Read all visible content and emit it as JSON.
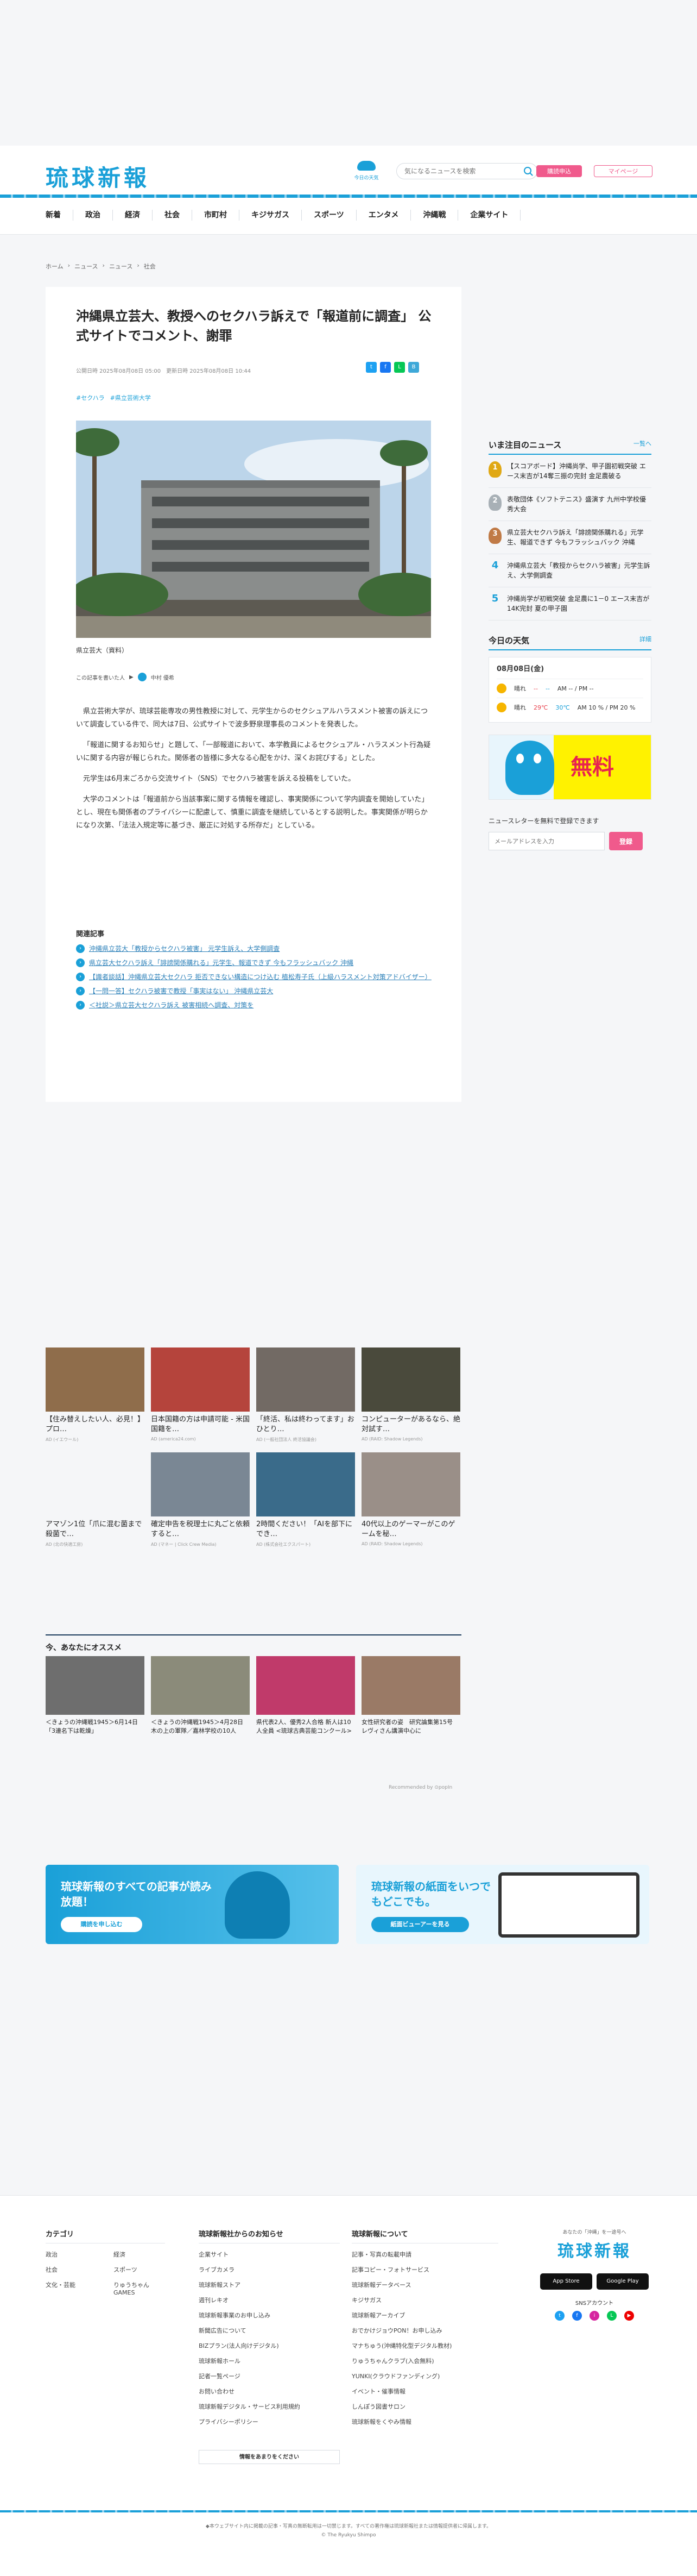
{
  "header": {
    "logo": "琉球新報",
    "weather_label": "今日の天気",
    "search_placeholder": "気になるニュースを検索",
    "subscribe": "購読申込",
    "mypage": "マイページ"
  },
  "nav": [
    "新着",
    "政治",
    "経済",
    "社会",
    "市町村",
    "キジサガス",
    "スポーツ",
    "エンタメ",
    "沖縄戦",
    "企業サイト"
  ],
  "breadcrumb": [
    "ホーム",
    "ニュース",
    "ニュース",
    "社会"
  ],
  "article": {
    "title": "沖縄県立芸大、教授へのセクハラ訴えで「報道前に調査」 公式サイトでコメント、謝罪",
    "published": "公開日時 2025年08月08日 05:00",
    "updated": "更新日時 2025年08月08日 10:44",
    "tags": [
      "#セクハラ",
      "#県立芸術大学"
    ],
    "photo_caption": "県立芸大（資料）",
    "author_label": "この記事を書いた人",
    "author": "中村 優希",
    "paragraphs": [
      "県立芸術大学が、琉球芸能専攻の男性教授に対して、元学生からのセクシュアルハラスメント被害の訴えについて調査している件で、同大は7日、公式サイトで波多野泉理事長のコメントを発表した。",
      "「報道に関するお知らせ」と題して、「一部報道において、本学教員によるセクシュアル・ハラスメント行為疑いに関する内容が報じられた。関係者の皆様に多大なる心配をかけ、深くお詫びする」とした。",
      "元学生は6月末ごろから交流サイト（SNS）でセクハラ被害を訴える投稿をしていた。",
      "大学のコメントは「報道前から当該事案に関する情報を確認し、事実関係について学内調査を開始していた」とし、現在も関係者のプライバシーに配慮して、慎重に調査を継続しているとする説明した。事実関係が明らかになり次第、「法法入規定等に基づき、厳正に対処する所存だ」としている。"
    ],
    "related_label": "関連記事",
    "related": [
      "沖縄県立芸大「教授からセクハラ被害」 元学生訴え、大学側調査",
      "県立芸大セクハラ訴え「誹謗関係購れる」元学生、報道できず 今もフラッシュバック 沖縄",
      "【識者談話】沖縄県立芸大セクハラ 拒否できない構造につけ込む 植松寿子氏（上級ハラスメント対策アドバイザー）",
      "【一問一答】セクハラ被害で教授「事実はない」 沖縄県立芸大",
      "＜社説＞県立芸大セクハラ訴え 被害相続へ調査、対策を"
    ]
  },
  "sidebar": {
    "ranking_title": "いま注目のニュース",
    "ranking_more": "一覧へ",
    "ranking": [
      {
        "n": "1",
        "text": "【スコアボード】沖縄尚学、甲子園初戦突破 エース末吉が14奪三振の完封 金足農破る"
      },
      {
        "n": "2",
        "text": "表敬団体《ソフトテニス》盛演す 九州中学校優秀大会"
      },
      {
        "n": "3",
        "text": "県立芸大セクハラ訴え「誹謗関係購れる」元学生、報道できず 今もフラッシュバック 沖縄"
      },
      {
        "n": "4",
        "text": "沖縄県立芸大「教授からセクハラ被害」元学生訴え、大学側調査"
      },
      {
        "n": "5",
        "text": "沖縄尚学が初戦突破 金足農に1－0 エース末吉が14K完封 夏の甲子園"
      }
    ],
    "weather_title": "今日の天気",
    "weather_more": "詳細",
    "weather_date": "08月08日(金)",
    "weather_rows": [
      {
        "label": "晴れ",
        "hi": "--",
        "lo": "--",
        "note": "AM -- / PM --"
      },
      {
        "label": "晴れ",
        "hi": "29℃",
        "lo": "30℃",
        "note": "AM 10 % / PM 20 %"
      }
    ],
    "banner_text": "無料",
    "newsletter_label": "ニュースレターを無料で登録できます",
    "newsletter_placeholder": "メールアドレスを入力",
    "newsletter_button": "登録"
  },
  "ads": [
    {
      "text": "【住み替えしたい人、必見！】プロ…",
      "src": "AD (イエウール)",
      "color": "#8f6d4b"
    },
    {
      "text": "日本国籍の方は申請可能 - 米国国籍を…",
      "src": "AD (america24.com)",
      "color": "#b5443c"
    },
    {
      "text": "「終活、私は終わってます」おひとり…",
      "src": "AD (一般社団法人 終活協議会)",
      "color": "#726a64"
    },
    {
      "text": "コンピューターがあるなら、絶対試す…",
      "src": "AD (RAID: Shadow Legends)",
      "color": "#4a4a3c"
    },
    {
      "text": "アマゾン1位「爪に混む菌まで殺菌で…",
      "src": "AD (北の快適工房)",
      "color": "#f5f6f8"
    },
    {
      "text": "確定申告を税理士に丸ごと依頼すると…",
      "src": "AD (マネー | Click Crew Media)",
      "color": "#7a8794"
    },
    {
      "text": "2時間ください！「AIを部下にでき…",
      "src": "AD (株式会社エクスパート)",
      "color": "#3a6b8a"
    },
    {
      "text": "40代以上のゲーマーがこのゲームを秘…",
      "src": "AD (RAID: Shadow Legends)",
      "color": "#9a8f88"
    }
  ],
  "reco_title": "今、あなたにオススメ",
  "reco": [
    {
      "text": "＜きょうの沖縄戦1945＞6月14日「3連名下は乾燥」",
      "color": "#6e6e6e"
    },
    {
      "text": "＜きょうの沖縄戦1945＞4月28日 木の上の軍隊／嘉林学校の10人",
      "color": "#8b8b7a"
    },
    {
      "text": "県代表2人、優秀2人合格 新人は10人全員 <琉球古典芸能コンクール>",
      "color": "#c03a6a"
    },
    {
      "text": "女性研究者の姿　研究論集第15号　レヴィさん講演中心に",
      "color": "#9a7a66"
    }
  ],
  "powered_by": "Recommended by ⊙popIn",
  "promo1": {
    "title": "琉球新報のすべての記事が読み放題！",
    "button": "購読を申し込む"
  },
  "promo2": {
    "title": "琉球新報の紙面をいつでもどこでも。",
    "button": "紙面ビューアーを見る"
  },
  "footer": {
    "categories_title": "カテゴリ",
    "categories": [
      "政治",
      "社会",
      "文化・芸能",
      "経済",
      "スポーツ",
      "りゅうちゃんGAMES"
    ],
    "site_title": "琉球新報社からのお知らせ",
    "site": [
      "企業サイト",
      "ライブカメラ",
      "琉球新報ストア",
      "週刊レキオ",
      "琉球新報事業のお申し込み",
      "新聞広告について",
      "BIZプラン(法人向けデジタル)",
      "琉球新報ホール",
      "記者一覧ページ",
      "お問い合わせ",
      "琉球新報デジタル・サービス利用規約",
      "プライバシーポリシー"
    ],
    "about_title": "琉球新報について",
    "about": [
      "記事・写真の転載申請",
      "記事コピー・フォトサービス",
      "琉球新報データベース",
      "キジサガス",
      "琉球新報アーカイブ",
      "おでかけジョウPON！お申し込み",
      "マナちゅう(沖縄特化型デジタル教材)",
      "りゅうちゃんクラブ(入会無料)",
      "YUNKI(クラウドファンディング)",
      "イベント・催事情報",
      "しんぽう図書サロン",
      "琉球新報をくやみ情報"
    ],
    "more_button": "情報をあまりをください",
    "logo_tag": "あなたの「沖縄」を一途号へ",
    "logo": "琉球新報",
    "app_store": "App Store",
    "google_play": "Google Play",
    "sns_title": "SNSアカウント",
    "copyright": "◆本ウェブサイト内に掲載の記事・写真の無断転用は一切禁じます。すべての著作権は琉球新報社または情報提供者に帰属します。",
    "copyright2": "© The Ryukyu Shimpo"
  }
}
